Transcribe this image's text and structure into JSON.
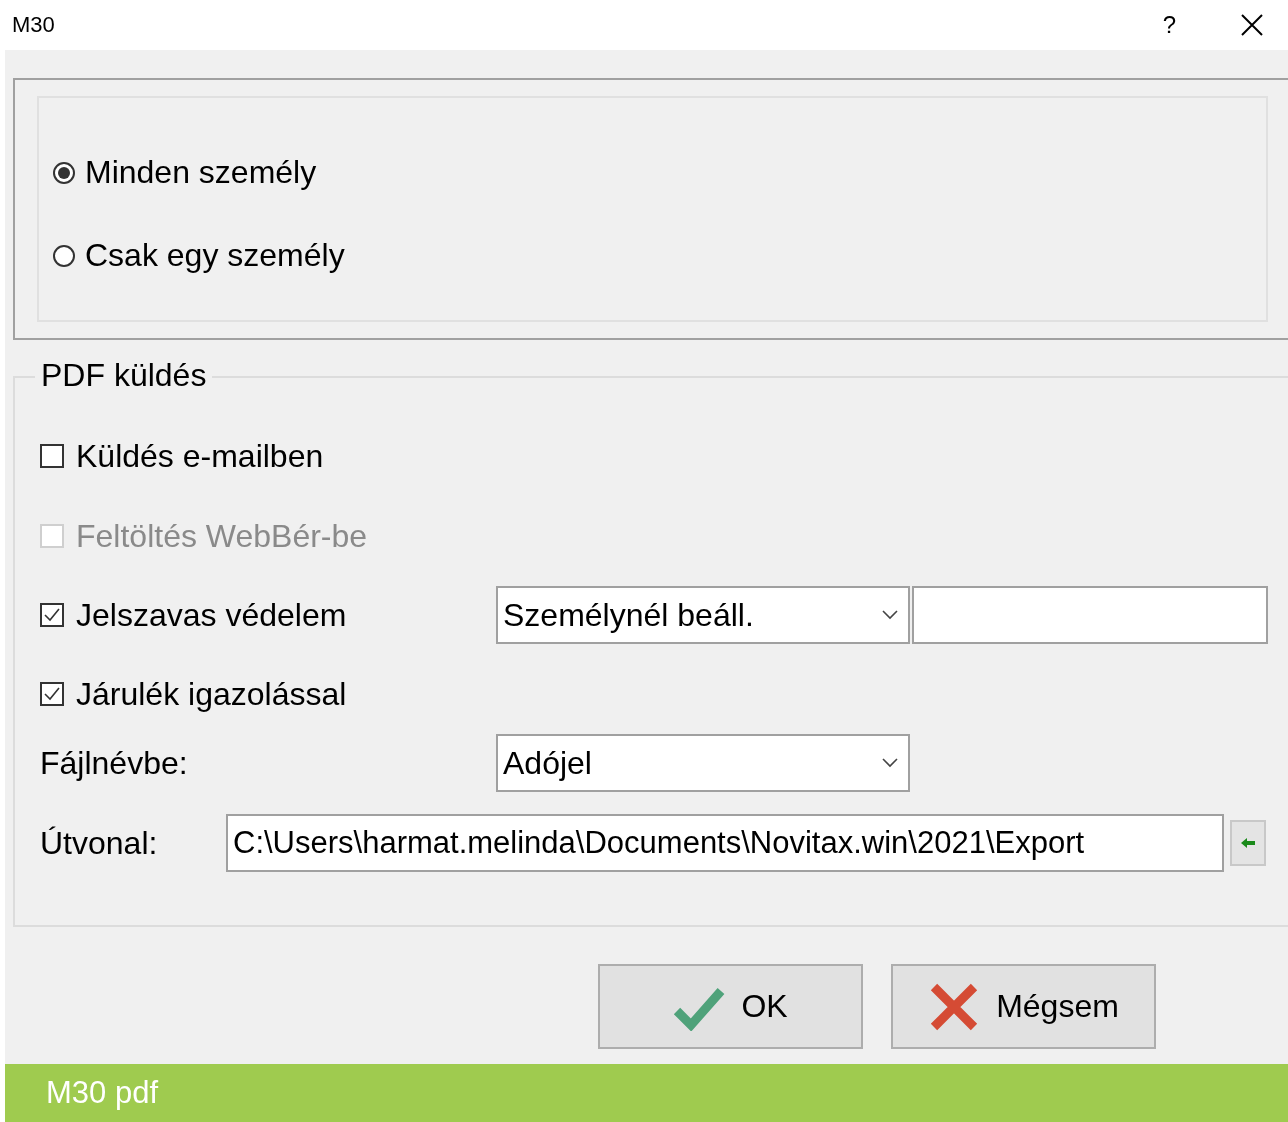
{
  "window": {
    "title": "M30",
    "help": "?"
  },
  "scope_options": [
    {
      "label": "Minden személy",
      "selected": true
    },
    {
      "label": "Csak egy személy",
      "selected": false
    }
  ],
  "pdf_group": {
    "title": "PDF küldés",
    "checkboxes": [
      {
        "label": "Küldés e-mailben",
        "checked": false,
        "disabled": false
      },
      {
        "label": "Feltöltés WebBér-be",
        "checked": false,
        "disabled": true
      },
      {
        "label": "Jelszavas védelem",
        "checked": true,
        "disabled": false,
        "select": "Személynél beáll.",
        "has_input": true
      },
      {
        "label": "Járulék igazolással",
        "checked": true,
        "disabled": false
      }
    ],
    "filename_label": "Fájlnévbe:",
    "filename_select": "Adójel",
    "path_label": "Útvonal:",
    "path_value": "C:\\Users\\harmat.melinda\\Documents\\Novitax.win\\2021\\Export"
  },
  "buttons": [
    {
      "label": "OK",
      "kind": "ok"
    },
    {
      "label": "Mégsem",
      "kind": "cancel"
    }
  ],
  "status_bar": "M30 pdf"
}
